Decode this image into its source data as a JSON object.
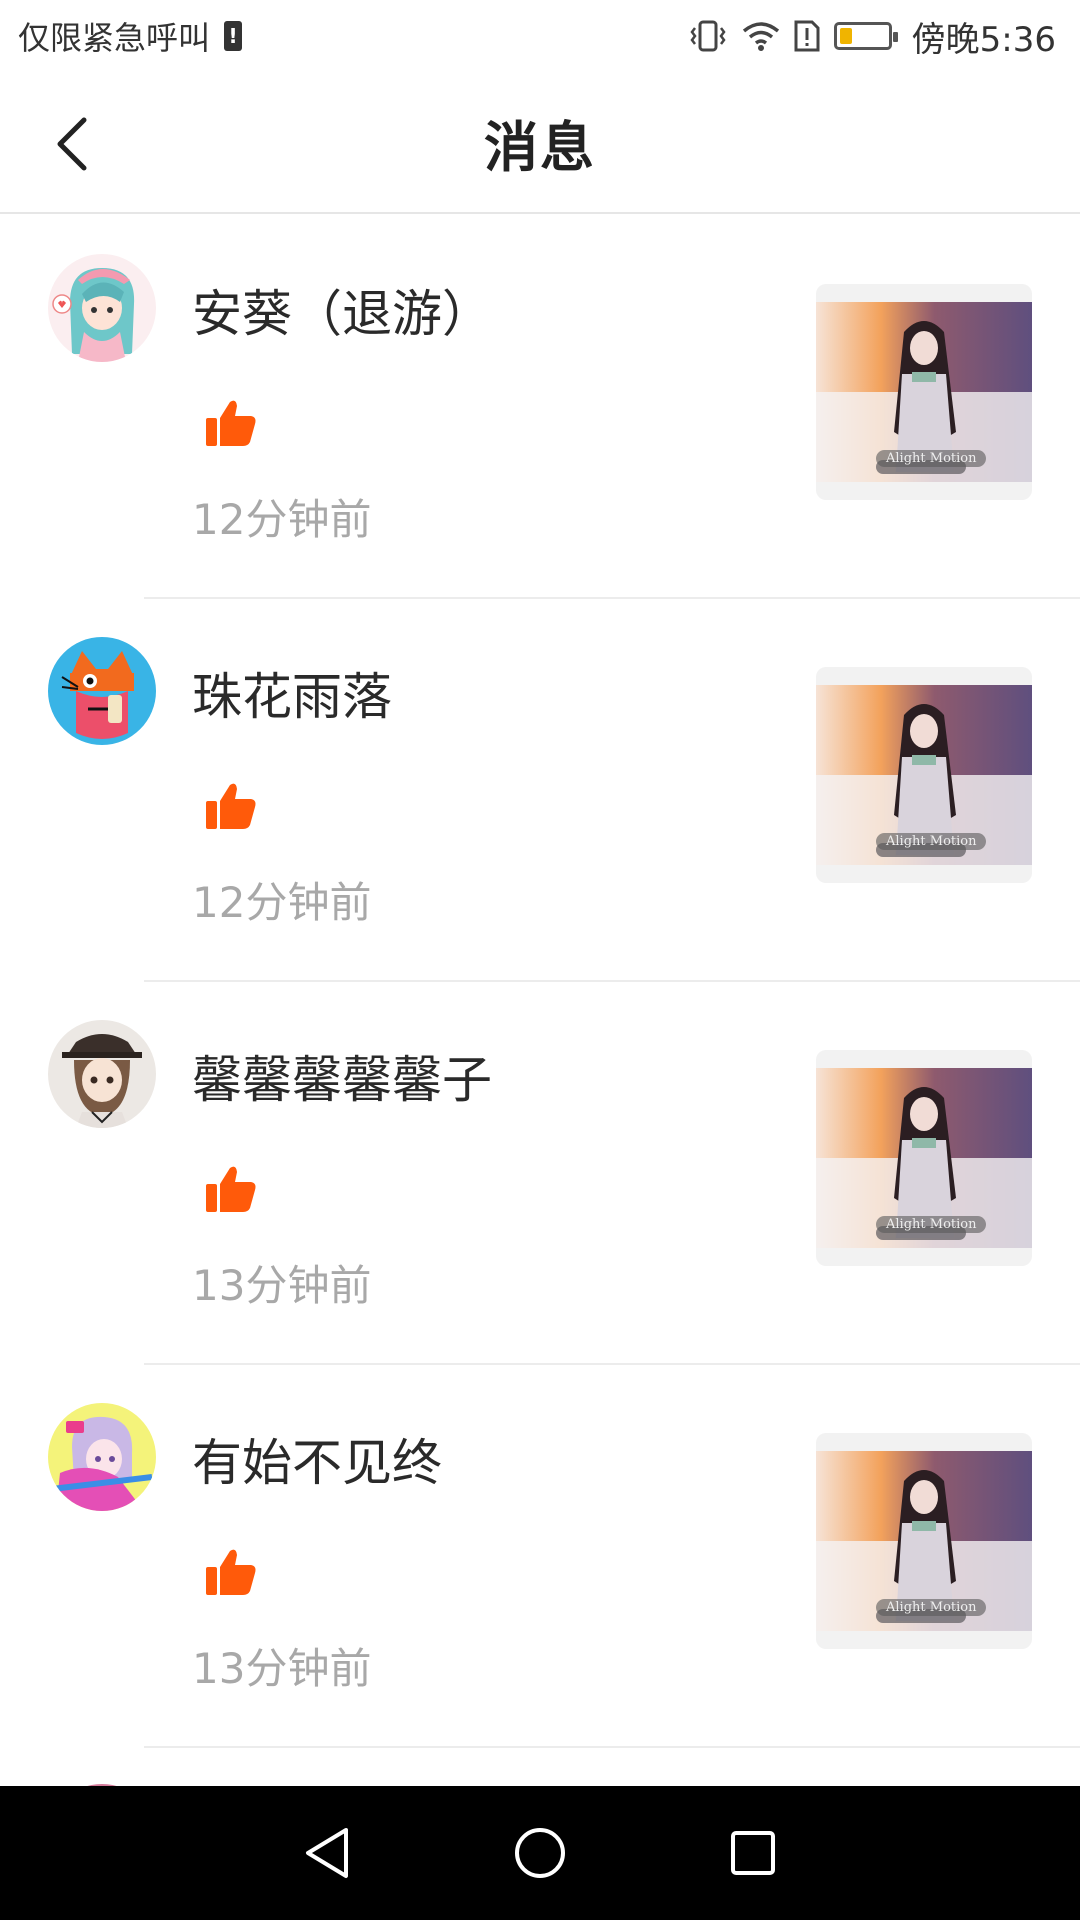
{
  "status_bar": {
    "carrier_text": "仅限紧急呼叫",
    "time": "傍晚5:36",
    "icons": [
      "sim-alert-icon",
      "vibrate-icon",
      "wifi-icon",
      "sim-card-alert-icon",
      "battery-icon"
    ]
  },
  "header": {
    "title": "消息",
    "back_icon": "back-arrow-icon"
  },
  "notifications": [
    {
      "username": "安葵（退游）",
      "action_icon": "thumbs-up-icon",
      "time": "12分钟前",
      "thumbnail_watermark": "Alight Motion"
    },
    {
      "username": "珠花雨落",
      "action_icon": "thumbs-up-icon",
      "time": "12分钟前",
      "thumbnail_watermark": "Alight Motion"
    },
    {
      "username": "馨馨馨馨馨子",
      "action_icon": "thumbs-up-icon",
      "time": "13分钟前",
      "thumbnail_watermark": "Alight Motion"
    },
    {
      "username": "有始不见终",
      "action_icon": "thumbs-up-icon",
      "time": "13分钟前",
      "thumbnail_watermark": "Alight Motion"
    }
  ],
  "colors": {
    "like_orange": "#ff5a0a",
    "time_gray": "#a8a8a8",
    "divider": "#ececec"
  },
  "nav_bar": {
    "buttons": [
      "back-triangle-icon",
      "home-circle-icon",
      "recents-square-icon"
    ]
  }
}
